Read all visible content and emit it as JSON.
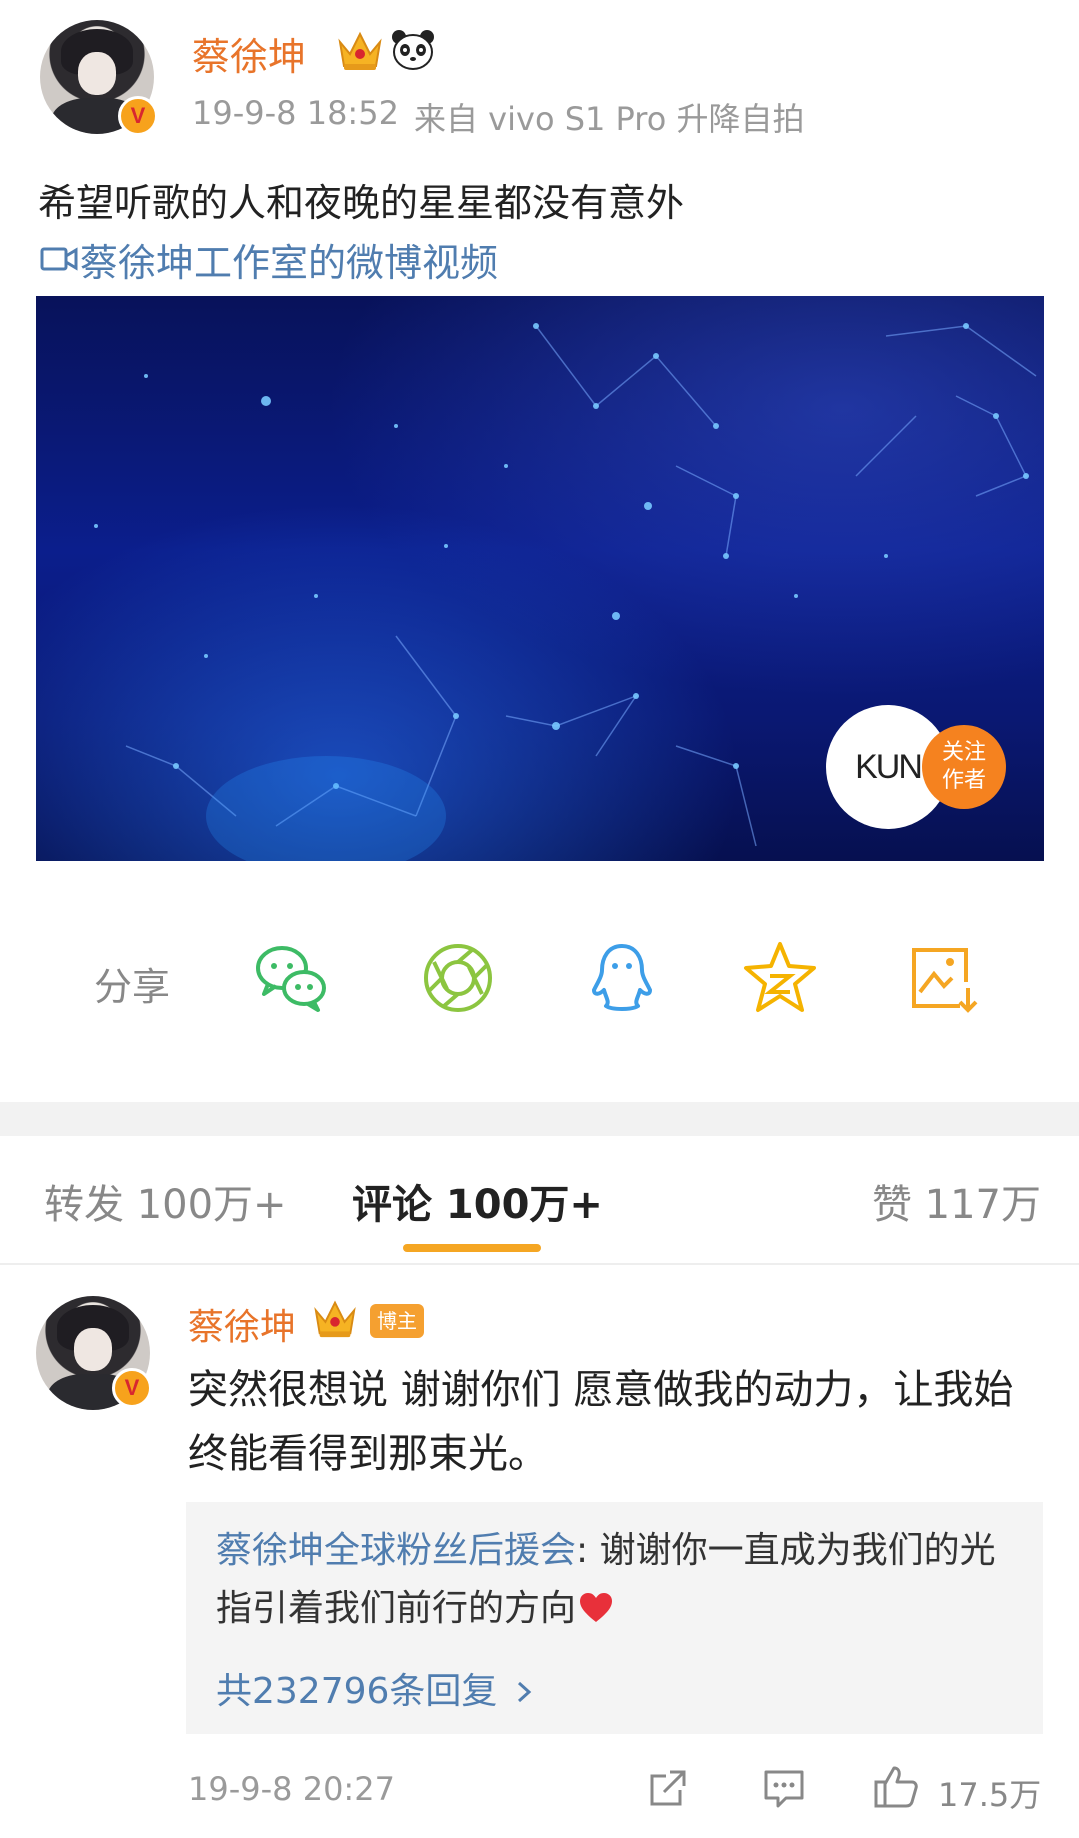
{
  "post": {
    "username": "蔡徐坤",
    "verified_badge": "V",
    "timestamp": "19-9-8 18:52",
    "source": "来自 vivo S1 Pro 升降自拍",
    "text": "希望听歌的人和夜晚的星星都没有意外",
    "video_link": "蔡徐坤工作室的微博视频",
    "video_logo": "KUN",
    "follow_line1": "关注",
    "follow_line2": "作者"
  },
  "share": {
    "label": "分享",
    "targets": [
      "wechat-icon",
      "moments-icon",
      "qq-icon",
      "qzone-icon",
      "save-image-icon"
    ]
  },
  "tabs": {
    "repost": "转发 100万+",
    "comments": "评论 100万+",
    "likes": "赞 117万"
  },
  "comment": {
    "username": "蔡徐坤",
    "badge": "博主",
    "text": "突然很想说 谢谢你们 愿意做我的动力，让我始终能看得到那束光。",
    "reply": {
      "author": "蔡徐坤全球粉丝后援会",
      "text": ": 谢谢你一直成为我们的光 指引着我们前行的方向",
      "count_text": "共232796条回复"
    },
    "timestamp": "19-9-8 20:27",
    "like_count": "17.5万"
  },
  "colors": {
    "username": "#e8742a",
    "link": "#507daf",
    "accent": "#f5a623",
    "follow": "#f5821f"
  }
}
